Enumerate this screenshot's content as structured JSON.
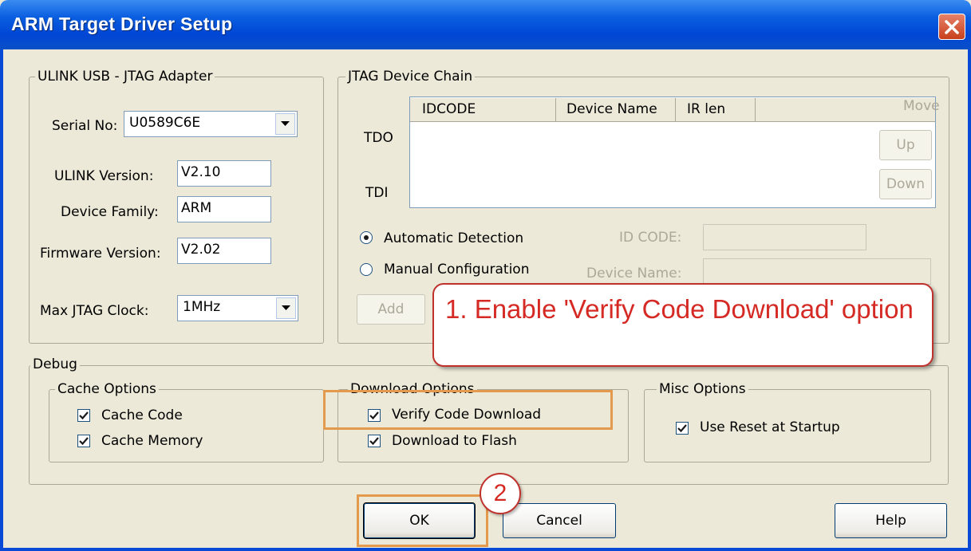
{
  "window": {
    "title": "ARM Target Driver Setup"
  },
  "adapter": {
    "group_label": "ULINK USB - JTAG Adapter",
    "serial_label": "Serial No:",
    "serial_value": "U0589C6E",
    "ulink_version_label": "ULINK Version:",
    "ulink_version_value": "V2.10",
    "device_family_label": "Device Family:",
    "device_family_value": "ARM",
    "firmware_label": "Firmware Version:",
    "firmware_value": "V2.02",
    "clock_label": "Max JTAG Clock:",
    "clock_value": "1MHz"
  },
  "jtag": {
    "group_label": "JTAG Device Chain",
    "tdo": "TDO",
    "tdi": "TDI",
    "columns": [
      "IDCODE",
      "Device Name",
      "IR len"
    ],
    "move_label": "Move",
    "up_label": "Up",
    "down_label": "Down",
    "auto_label": "Automatic Detection",
    "manual_label": "Manual Configuration",
    "idcode_label": "ID CODE:",
    "device_name_label": "Device Name:",
    "add_label": "Add"
  },
  "debug": {
    "group_label": "Debug",
    "cache": {
      "label": "Cache Options",
      "code": "Cache Code",
      "memory": "Cache Memory"
    },
    "download": {
      "label": "Download Options",
      "verify": "Verify Code Download",
      "flash": "Download to Flash"
    },
    "misc": {
      "label": "Misc Options",
      "reset": "Use Reset at Startup"
    }
  },
  "buttons": {
    "ok": "OK",
    "cancel": "Cancel",
    "help": "Help"
  },
  "annotations": {
    "callout": "1. Enable 'Verify Code Download' option",
    "step2": "2"
  }
}
